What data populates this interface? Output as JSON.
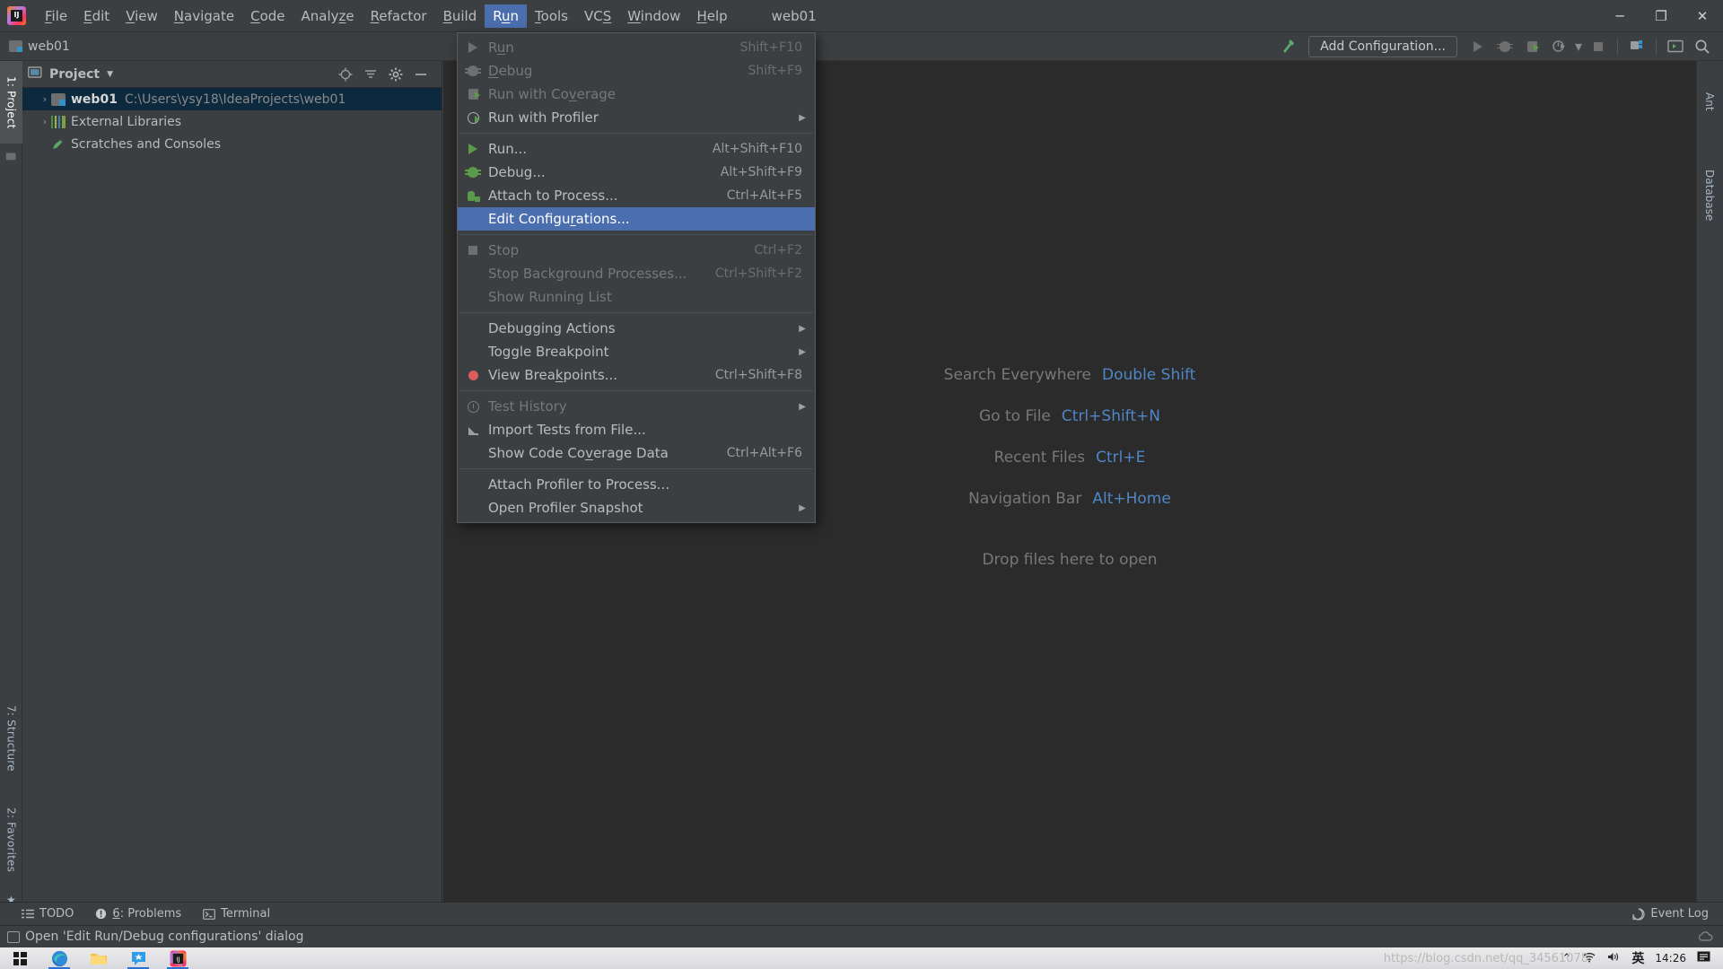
{
  "titlebar": {
    "logo": "intellij-idea-logo",
    "menus": [
      {
        "label": "File",
        "mnemonic": "F"
      },
      {
        "label": "Edit",
        "mnemonic": "E"
      },
      {
        "label": "View",
        "mnemonic": "V"
      },
      {
        "label": "Navigate",
        "mnemonic": "N"
      },
      {
        "label": "Code",
        "mnemonic": "C"
      },
      {
        "label": "Analyze",
        "mnemonic": "z"
      },
      {
        "label": "Refactor",
        "mnemonic": "R"
      },
      {
        "label": "Build",
        "mnemonic": "B"
      },
      {
        "label": "Run",
        "mnemonic": "u",
        "active": true
      },
      {
        "label": "Tools",
        "mnemonic": "T"
      },
      {
        "label": "VCS",
        "mnemonic": "S"
      },
      {
        "label": "Window",
        "mnemonic": "W"
      },
      {
        "label": "Help",
        "mnemonic": "H"
      }
    ],
    "project_name": "web01",
    "minimize": "─",
    "maximize": "❐",
    "close": "✕"
  },
  "toolbar": {
    "project_label": "web01",
    "add_configuration": "Add Configuration...",
    "icons": [
      "build-hammer-icon",
      "run-icon",
      "debug-icon",
      "run-coverage-icon",
      "profiler-icon",
      "stop-icon",
      "project-structure-icon",
      "terminal-icon",
      "search-everywhere-icon"
    ]
  },
  "left_strip": {
    "tabs": [
      {
        "label": "1: Project",
        "selected": true
      },
      {
        "label": "7: Structure",
        "selected": false
      },
      {
        "label": "2: Favorites",
        "selected": false
      }
    ]
  },
  "right_strip": {
    "tabs": [
      {
        "label": "Ant",
        "icon": "ant-icon"
      },
      {
        "label": "Database",
        "icon": "database-icon"
      }
    ]
  },
  "project_panel": {
    "title": "Project",
    "tree": [
      {
        "name": "web01",
        "path": "C:\\Users\\ysy18\\IdeaProjects\\web01",
        "icon": "module-icon",
        "selected": true,
        "arrow": "›"
      },
      {
        "name": "External Libraries",
        "path": "",
        "icon": "library-icon",
        "selected": false,
        "arrow": "›"
      },
      {
        "name": "Scratches and Consoles",
        "path": "",
        "icon": "scratch-icon",
        "selected": false,
        "arrow": ""
      }
    ]
  },
  "run_menu": {
    "items": [
      {
        "label": "Run",
        "mnemonic": "u",
        "shortcut": "Shift+F10",
        "icon": "run-icon",
        "disabled": true
      },
      {
        "label": "Debug",
        "mnemonic": "D",
        "shortcut": "Shift+F9",
        "icon": "debug-icon",
        "disabled": true
      },
      {
        "label": "Run with Coverage",
        "mnemonic": "v",
        "shortcut": "",
        "icon": "coverage-icon",
        "disabled": true
      },
      {
        "label": "Run with Profiler",
        "mnemonic": "",
        "shortcut": "",
        "icon": "profiler-icon",
        "disabled": false,
        "submenu": true
      },
      {
        "separator": true
      },
      {
        "label": "Run...",
        "mnemonic": "",
        "shortcut": "Alt+Shift+F10",
        "icon": "run-green-icon",
        "disabled": false
      },
      {
        "label": "Debug...",
        "mnemonic": "",
        "shortcut": "Alt+Shift+F9",
        "icon": "debug-green-icon",
        "disabled": false
      },
      {
        "label": "Attach to Process...",
        "mnemonic": "",
        "shortcut": "Ctrl+Alt+F5",
        "icon": "attach-icon",
        "disabled": false
      },
      {
        "label": "Edit Configurations...",
        "mnemonic": "r",
        "shortcut": "",
        "icon": "",
        "disabled": false,
        "highlighted": true
      },
      {
        "separator": true
      },
      {
        "label": "Stop",
        "mnemonic": "",
        "shortcut": "Ctrl+F2",
        "icon": "stop-icon",
        "disabled": true
      },
      {
        "label": "Stop Background Processes...",
        "mnemonic": "",
        "shortcut": "Ctrl+Shift+F2",
        "icon": "",
        "disabled": true
      },
      {
        "label": "Show Running List",
        "mnemonic": "",
        "shortcut": "",
        "icon": "",
        "disabled": true
      },
      {
        "separator": true
      },
      {
        "label": "Debugging Actions",
        "mnemonic": "",
        "shortcut": "",
        "icon": "",
        "disabled": false,
        "submenu": true
      },
      {
        "label": "Toggle Breakpoint",
        "mnemonic": "",
        "shortcut": "",
        "icon": "",
        "disabled": false,
        "submenu": true
      },
      {
        "label": "View Breakpoints...",
        "mnemonic": "k",
        "shortcut": "Ctrl+Shift+F8",
        "icon": "breakpoint-icon",
        "disabled": false
      },
      {
        "separator": true
      },
      {
        "label": "Test History",
        "mnemonic": "",
        "shortcut": "",
        "icon": "clock-icon",
        "disabled": true,
        "submenu": true
      },
      {
        "label": "Import Tests from File...",
        "mnemonic": "",
        "shortcut": "",
        "icon": "import-icon",
        "disabled": false
      },
      {
        "label": "Show Code Coverage Data",
        "mnemonic": "v",
        "shortcut": "Ctrl+Alt+F6",
        "icon": "",
        "disabled": false
      },
      {
        "separator": true
      },
      {
        "label": "Attach Profiler to Process...",
        "mnemonic": "",
        "shortcut": "",
        "icon": "",
        "disabled": false
      },
      {
        "label": "Open Profiler Snapshot",
        "mnemonic": "",
        "shortcut": "",
        "icon": "",
        "disabled": false,
        "submenu": true
      }
    ]
  },
  "editor": {
    "tips": [
      {
        "text": "Search Everywhere",
        "key": "Double Shift"
      },
      {
        "text": "Go to File",
        "key": "Ctrl+Shift+N"
      },
      {
        "text": "Recent Files",
        "key": "Ctrl+E"
      },
      {
        "text": "Navigation Bar",
        "key": "Alt+Home"
      }
    ],
    "drop_text": "Drop files here to open"
  },
  "bottom_bar": {
    "items": [
      {
        "label": "TODO",
        "icon": "todo-icon"
      },
      {
        "label": "6: Problems",
        "mnemonic": "6",
        "icon": "problems-icon"
      },
      {
        "label": "Terminal",
        "icon": "terminal-icon"
      }
    ],
    "event_log": "Event Log"
  },
  "status_bar": {
    "message": "Open 'Edit Run/Debug configurations' dialog"
  },
  "taskbar": {
    "apps": [
      "windows-start-icon",
      "edge-icon",
      "file-explorer-icon",
      "wechat-icon",
      "intellij-idea-icon"
    ],
    "tray": {
      "watermark": "https://blog.csdn.net/qq_34561078",
      "chevron": "⌃",
      "network": "wifi-icon",
      "volume": "speaker-icon",
      "ime": "英",
      "time": "14:26",
      "notification": "notification-icon"
    }
  },
  "colors": {
    "background": "#3c3f41",
    "editor_bg": "#2b2b2b",
    "accent_blue": "#4b6eaf",
    "link_blue": "#4f86c6",
    "text": "#bbbbbb",
    "disabled_text": "#777777",
    "selection": "#0d293e"
  }
}
